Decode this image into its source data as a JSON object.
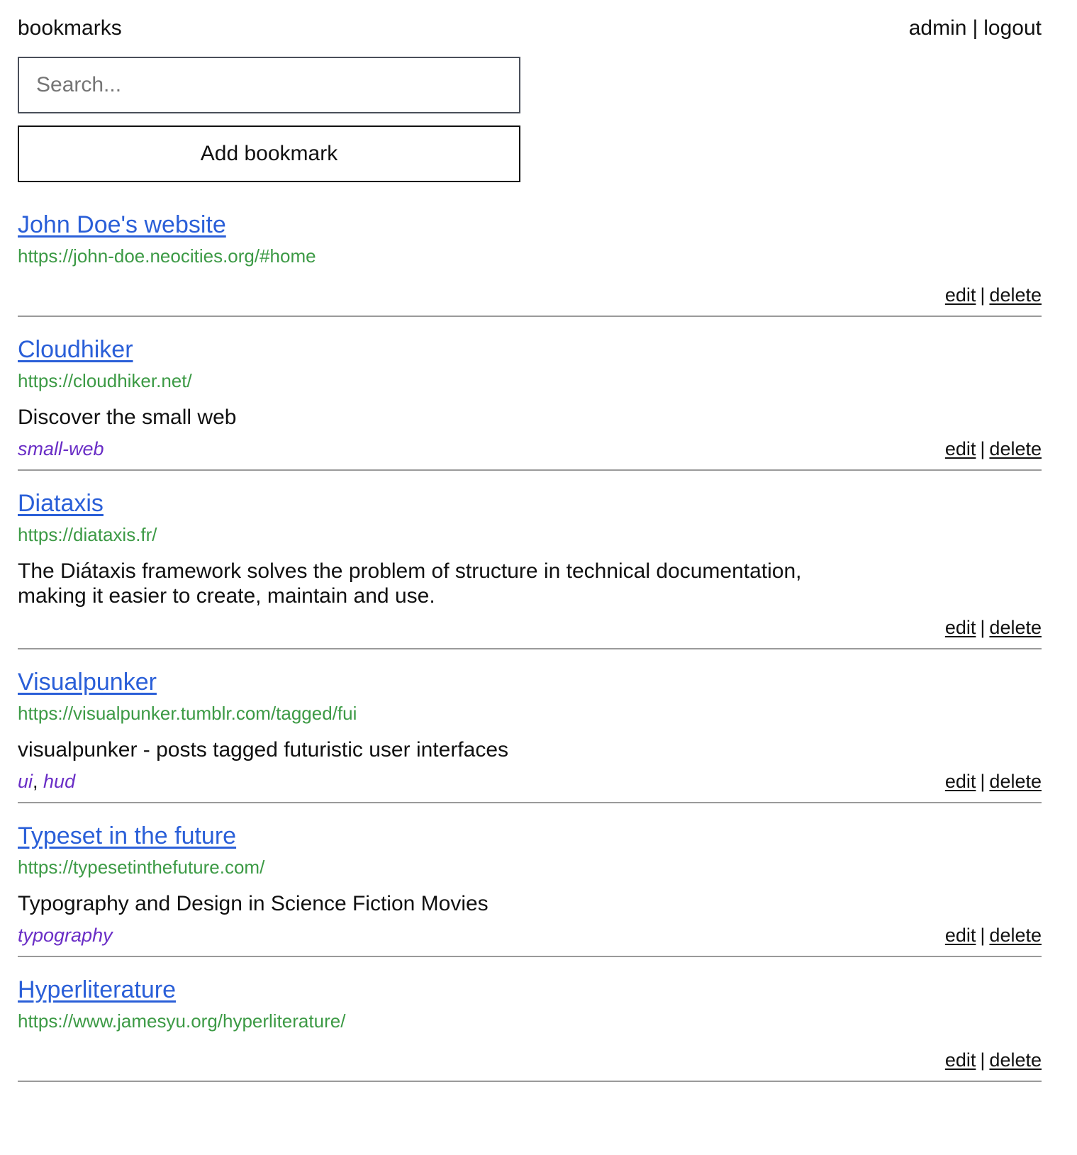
{
  "header": {
    "brand": "bookmarks",
    "user": "admin",
    "separator": "|",
    "logout": "logout"
  },
  "search": {
    "placeholder": "Search..."
  },
  "add_button": "Add bookmark",
  "action_labels": {
    "edit": "edit",
    "separator": "|",
    "delete": "delete"
  },
  "bookmarks": [
    {
      "title": "John Doe's website",
      "url": "https://john-doe.neocities.org/#home",
      "description": "",
      "tags": []
    },
    {
      "title": "Cloudhiker",
      "url": "https://cloudhiker.net/",
      "description": "Discover the small web",
      "tags": [
        "small-web"
      ]
    },
    {
      "title": "Diataxis",
      "url": "https://diataxis.fr/",
      "description": "The Diátaxis framework solves the problem of structure in technical documentation, making it easier to create, maintain and use.",
      "tags": []
    },
    {
      "title": "Visualpunker",
      "url": "https://visualpunker.tumblr.com/tagged/fui",
      "description": "visualpunker - posts tagged futuristic user interfaces",
      "tags": [
        "ui",
        "hud"
      ]
    },
    {
      "title": "Typeset in the future",
      "url": "https://typesetinthefuture.com/",
      "description": "Typography and Design in Science Fiction Movies",
      "tags": [
        "typography"
      ]
    },
    {
      "title": "Hyperliterature",
      "url": "https://www.jamesyu.org/hyperliterature/",
      "description": "",
      "tags": []
    }
  ],
  "colors": {
    "link": "#2a5fd8",
    "url": "#3c9a45",
    "tag": "#6a2ec6",
    "divider": "#9a9a9a"
  }
}
